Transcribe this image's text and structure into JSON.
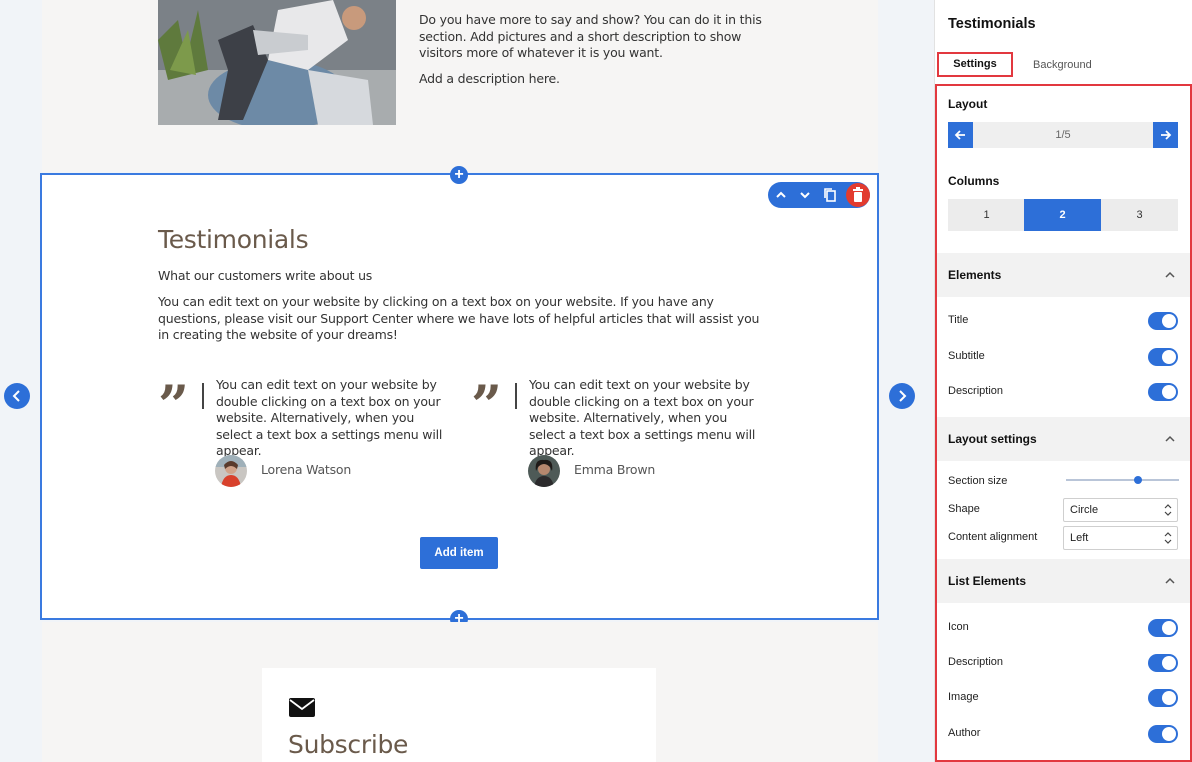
{
  "canvas": {
    "about": {
      "text_1": "Do you have more to say and show? You can do it in this section. Add pictures and a short description to show visitors more of whatever it is you want.",
      "text_2": "Add a description here."
    },
    "testimonials": {
      "title": "Testimonials",
      "subtitle": "What our customers write about us",
      "description": "You can edit text on your website by clicking on a text box on your website. If you have any questions, please visit our Support Center where we have lots of helpful articles that will assist you in creating the website of your dreams!",
      "items": [
        {
          "quote_icon": "quote-icon",
          "text": "You can edit text on your website by double clicking on a text box on your website. Alternatively, when you select a text box a settings menu will appear.",
          "author": "Lorena Watson"
        },
        {
          "quote_icon": "quote-icon",
          "text": "You can edit text on your website by double clicking on a text box on your website. Alternatively, when you select a text box a settings menu will appear.",
          "author": "Emma Brown"
        }
      ],
      "add_item_label": "Add item"
    },
    "subscribe": {
      "icon": "mail-icon",
      "title": "Subscribe"
    },
    "toolbar": {
      "icons": [
        "chevron-up-icon",
        "chevron-down-icon",
        "copy-icon",
        "trash-icon"
      ]
    },
    "accent_color": "#2d6fd8",
    "delete_color": "#e23b2f"
  },
  "panel": {
    "title": "Testimonials",
    "tabs": [
      "Settings",
      "Background"
    ],
    "active_tab": "Settings",
    "layout": {
      "label": "Layout",
      "value": "1/5"
    },
    "columns": {
      "label": "Columns",
      "options": [
        "1",
        "2",
        "3"
      ],
      "selected": "2"
    },
    "elements": {
      "label": "Elements",
      "items": [
        {
          "label": "Title",
          "on": true
        },
        {
          "label": "Subtitle",
          "on": true
        },
        {
          "label": "Description",
          "on": true
        }
      ]
    },
    "layout_settings": {
      "label": "Layout settings",
      "section_size_label": "Section size",
      "section_size_value": 0.65,
      "shape_label": "Shape",
      "shape_value": "Circle",
      "alignment_label": "Content alignment",
      "alignment_value": "Left"
    },
    "list_elements": {
      "label": "List Elements",
      "items": [
        {
          "label": "Icon",
          "on": true
        },
        {
          "label": "Description",
          "on": true
        },
        {
          "label": "Image",
          "on": true
        },
        {
          "label": "Author",
          "on": true
        }
      ]
    },
    "highlight_color": "#e2383f"
  }
}
